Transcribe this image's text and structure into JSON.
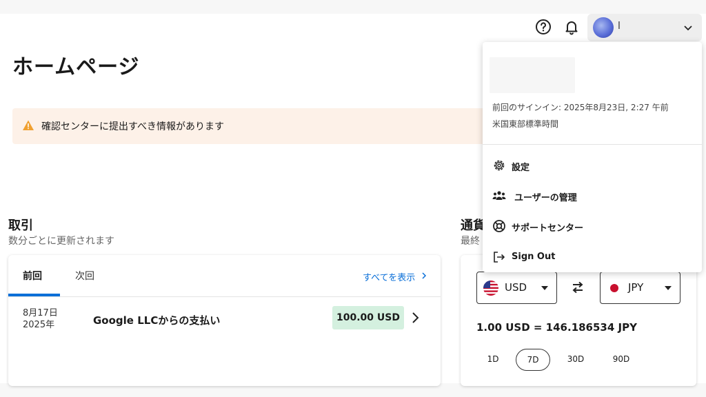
{
  "header": {
    "account_name": "l"
  },
  "page_title": "ホームページ",
  "alert": {
    "text": "確認センターに提出すべき情報があります"
  },
  "transactions": {
    "title": "取引",
    "subtitle": "数分ごとに更新されます",
    "tabs": [
      "前回",
      "次回"
    ],
    "show_all": "すべてを表示",
    "items": [
      {
        "date_line1": "8月17日",
        "date_line2": "2025年",
        "description": "Google LLCからの支払い",
        "amount": "100.00 USD"
      }
    ]
  },
  "fx": {
    "title": "通貨",
    "subtitle": "最終",
    "from_currency": "USD",
    "to_currency": "JPY",
    "rate_text": "1.00 USD = 146.186534 JPY",
    "ranges": [
      "1D",
      "7D",
      "30D",
      "90D"
    ],
    "selected_range": "7D"
  },
  "account_menu": {
    "last_signin": "前回のサインイン: 2025年8月23日, 2:27 午前",
    "timezone": "米国東部標準時間",
    "items": [
      {
        "label": "設定",
        "icon": "gear-icon"
      },
      {
        "label": "ユーザーの管理",
        "icon": "users-icon"
      },
      {
        "label": "サポートセンター",
        "icon": "lifebuoy-icon"
      },
      {
        "label": "Sign Out",
        "icon": "sign-out-icon"
      }
    ]
  },
  "colors": {
    "accent": "#0a6fd8",
    "alert_bg": "#fdf1e8",
    "amount_bg": "#d4f0df",
    "warning": "#f0a030"
  }
}
